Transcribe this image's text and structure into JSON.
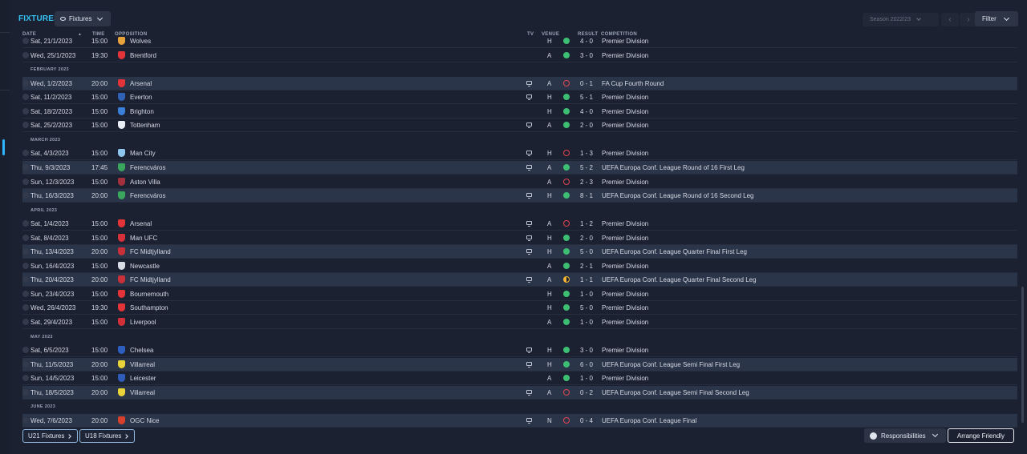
{
  "header": {
    "title": "FIXTURES",
    "view_dropdown": "Fixtures",
    "season": "Season 2022/23",
    "filter": "Filter"
  },
  "columns": {
    "date": "DATE",
    "time": "TIME",
    "opposition": "OPPOSITION",
    "tv": "TV",
    "venue": "VENUE",
    "result": "RESULT",
    "competition": "COMPETITION"
  },
  "colors": {
    "accent": "#34c2f5",
    "win": "#3dbf73",
    "loss": "#e04650",
    "draw": "#f5b533",
    "highlight": "#2b3549"
  },
  "rows": [
    {
      "date": "Sat, 21/1/2023",
      "time": "15:00",
      "opp": "Wolves",
      "tv": false,
      "venue": "H",
      "result": "W",
      "score": "4 - 0",
      "comp": "Premier Division",
      "hl": false,
      "crest": "#e8a23a"
    },
    {
      "date": "Wed, 25/1/2023",
      "time": "19:30",
      "opp": "Brentford",
      "tv": false,
      "venue": "A",
      "result": "W",
      "score": "3 - 0",
      "comp": "Premier Division",
      "hl": false,
      "crest": "#e3343a"
    },
    {
      "month": "FEBRUARY 2023"
    },
    {
      "date": "Wed, 1/2/2023",
      "time": "20:00",
      "opp": "Arsenal",
      "tv": true,
      "venue": "A",
      "result": "L",
      "score": "0 - 1",
      "comp": "FA Cup Fourth Round",
      "hl": true,
      "crest": "#e3343a"
    },
    {
      "date": "Sat, 11/2/2023",
      "time": "15:00",
      "opp": "Everton",
      "tv": true,
      "venue": "H",
      "result": "W",
      "score": "5 - 1",
      "comp": "Premier Division",
      "hl": false,
      "crest": "#2f62b6"
    },
    {
      "date": "Sat, 18/2/2023",
      "time": "15:00",
      "opp": "Brighton",
      "tv": false,
      "venue": "H",
      "result": "W",
      "score": "4 - 0",
      "comp": "Premier Division",
      "hl": false,
      "crest": "#3b7fd6"
    },
    {
      "date": "Sat, 25/2/2023",
      "time": "15:00",
      "opp": "Tottenham",
      "tv": true,
      "venue": "A",
      "result": "W",
      "score": "2 - 0",
      "comp": "Premier Division",
      "hl": false,
      "crest": "#e9edf4"
    },
    {
      "month": "MARCH 2023"
    },
    {
      "date": "Sat, 4/3/2023",
      "time": "15:00",
      "opp": "Man City",
      "tv": true,
      "venue": "H",
      "result": "L",
      "score": "1 - 3",
      "comp": "Premier Division",
      "hl": false,
      "crest": "#8ec6ee"
    },
    {
      "date": "Thu, 9/3/2023",
      "time": "17:45",
      "opp": "Ferencváros",
      "tv": true,
      "venue": "A",
      "result": "W",
      "score": "5 - 2",
      "comp": "UEFA Europa Conf. League Round of 16  First Leg",
      "hl": true,
      "crest": "#3aa55c"
    },
    {
      "date": "Sun, 12/3/2023",
      "time": "15:00",
      "opp": "Aston Villa",
      "tv": false,
      "venue": "A",
      "result": "L",
      "score": "2 - 3",
      "comp": "Premier Division",
      "hl": false,
      "crest": "#a3303d"
    },
    {
      "date": "Thu, 16/3/2023",
      "time": "20:00",
      "opp": "Ferencváros",
      "tv": true,
      "venue": "H",
      "result": "W",
      "score": "8 - 1",
      "comp": "UEFA Europa Conf. League Round of 16  Second Leg",
      "hl": true,
      "crest": "#3aa55c"
    },
    {
      "month": "APRIL 2023"
    },
    {
      "date": "Sat, 1/4/2023",
      "time": "15:00",
      "opp": "Arsenal",
      "tv": true,
      "venue": "A",
      "result": "L",
      "score": "1 - 2",
      "comp": "Premier Division",
      "hl": false,
      "crest": "#e3343a"
    },
    {
      "date": "Sat, 8/4/2023",
      "time": "15:00",
      "opp": "Man UFC",
      "tv": true,
      "venue": "H",
      "result": "W",
      "score": "2 - 0",
      "comp": "Premier Division",
      "hl": false,
      "crest": "#d6313a"
    },
    {
      "date": "Thu, 13/4/2023",
      "time": "20:00",
      "opp": "FC Midtjylland",
      "tv": true,
      "venue": "H",
      "result": "W",
      "score": "5 - 0",
      "comp": "UEFA Europa Conf. League Quarter Final First Leg",
      "hl": true,
      "crest": "#c8303a"
    },
    {
      "date": "Sun, 16/4/2023",
      "time": "15:00",
      "opp": "Newcastle",
      "tv": false,
      "venue": "A",
      "result": "W",
      "score": "2 - 1",
      "comp": "Premier Division",
      "hl": false,
      "crest": "#d8dce4"
    },
    {
      "date": "Thu, 20/4/2023",
      "time": "20:00",
      "opp": "FC Midtjylland",
      "tv": true,
      "venue": "A",
      "result": "D",
      "score": "1 - 1",
      "comp": "UEFA Europa Conf. League Quarter Final Second Leg",
      "hl": true,
      "crest": "#c8303a"
    },
    {
      "date": "Sun, 23/4/2023",
      "time": "15:00",
      "opp": "Bournemouth",
      "tv": false,
      "venue": "H",
      "result": "W",
      "score": "1 - 0",
      "comp": "Premier Division",
      "hl": false,
      "crest": "#e3343a"
    },
    {
      "date": "Wed, 26/4/2023",
      "time": "19:30",
      "opp": "Southampton",
      "tv": false,
      "venue": "H",
      "result": "W",
      "score": "5 - 0",
      "comp": "Premier Division",
      "hl": false,
      "crest": "#e3343a"
    },
    {
      "date": "Sat, 29/4/2023",
      "time": "15:00",
      "opp": "Liverpool",
      "tv": false,
      "venue": "A",
      "result": "W",
      "score": "1 - 0",
      "comp": "Premier Division",
      "hl": false,
      "crest": "#d23039"
    },
    {
      "month": "MAY 2023"
    },
    {
      "date": "Sat, 6/5/2023",
      "time": "15:00",
      "opp": "Chelsea",
      "tv": true,
      "venue": "H",
      "result": "W",
      "score": "3 - 0",
      "comp": "Premier Division",
      "hl": false,
      "crest": "#2e5fc0"
    },
    {
      "date": "Thu, 11/5/2023",
      "time": "20:00",
      "opp": "Villarreal",
      "tv": true,
      "venue": "H",
      "result": "W",
      "score": "6 - 0",
      "comp": "UEFA Europa Conf. League Semi Final First Leg",
      "hl": true,
      "crest": "#e8d43a"
    },
    {
      "date": "Sun, 14/5/2023",
      "time": "15:00",
      "opp": "Leicester",
      "tv": false,
      "venue": "A",
      "result": "W",
      "score": "1 - 0",
      "comp": "Premier Division",
      "hl": false,
      "crest": "#2f5cb8"
    },
    {
      "date": "Thu, 18/5/2023",
      "time": "20:00",
      "opp": "Villarreal",
      "tv": true,
      "venue": "A",
      "result": "L",
      "score": "0 - 2",
      "comp": "UEFA Europa Conf. League Semi Final Second Leg",
      "hl": true,
      "crest": "#e8d43a"
    },
    {
      "month": "JUNE 2023"
    },
    {
      "date": "Wed, 7/6/2023",
      "time": "20:00",
      "opp": "OGC Nice",
      "tv": true,
      "venue": "N",
      "result": "L",
      "score": "0 - 4",
      "comp": "UEFA Europa Conf. League Final",
      "hl": true,
      "crest": "#d8402e"
    }
  ],
  "footer": {
    "u21": "U21 Fixtures",
    "u18": "U18 Fixtures",
    "responsibilities": "Responsibilities",
    "arrange": "Arrange Friendly"
  }
}
